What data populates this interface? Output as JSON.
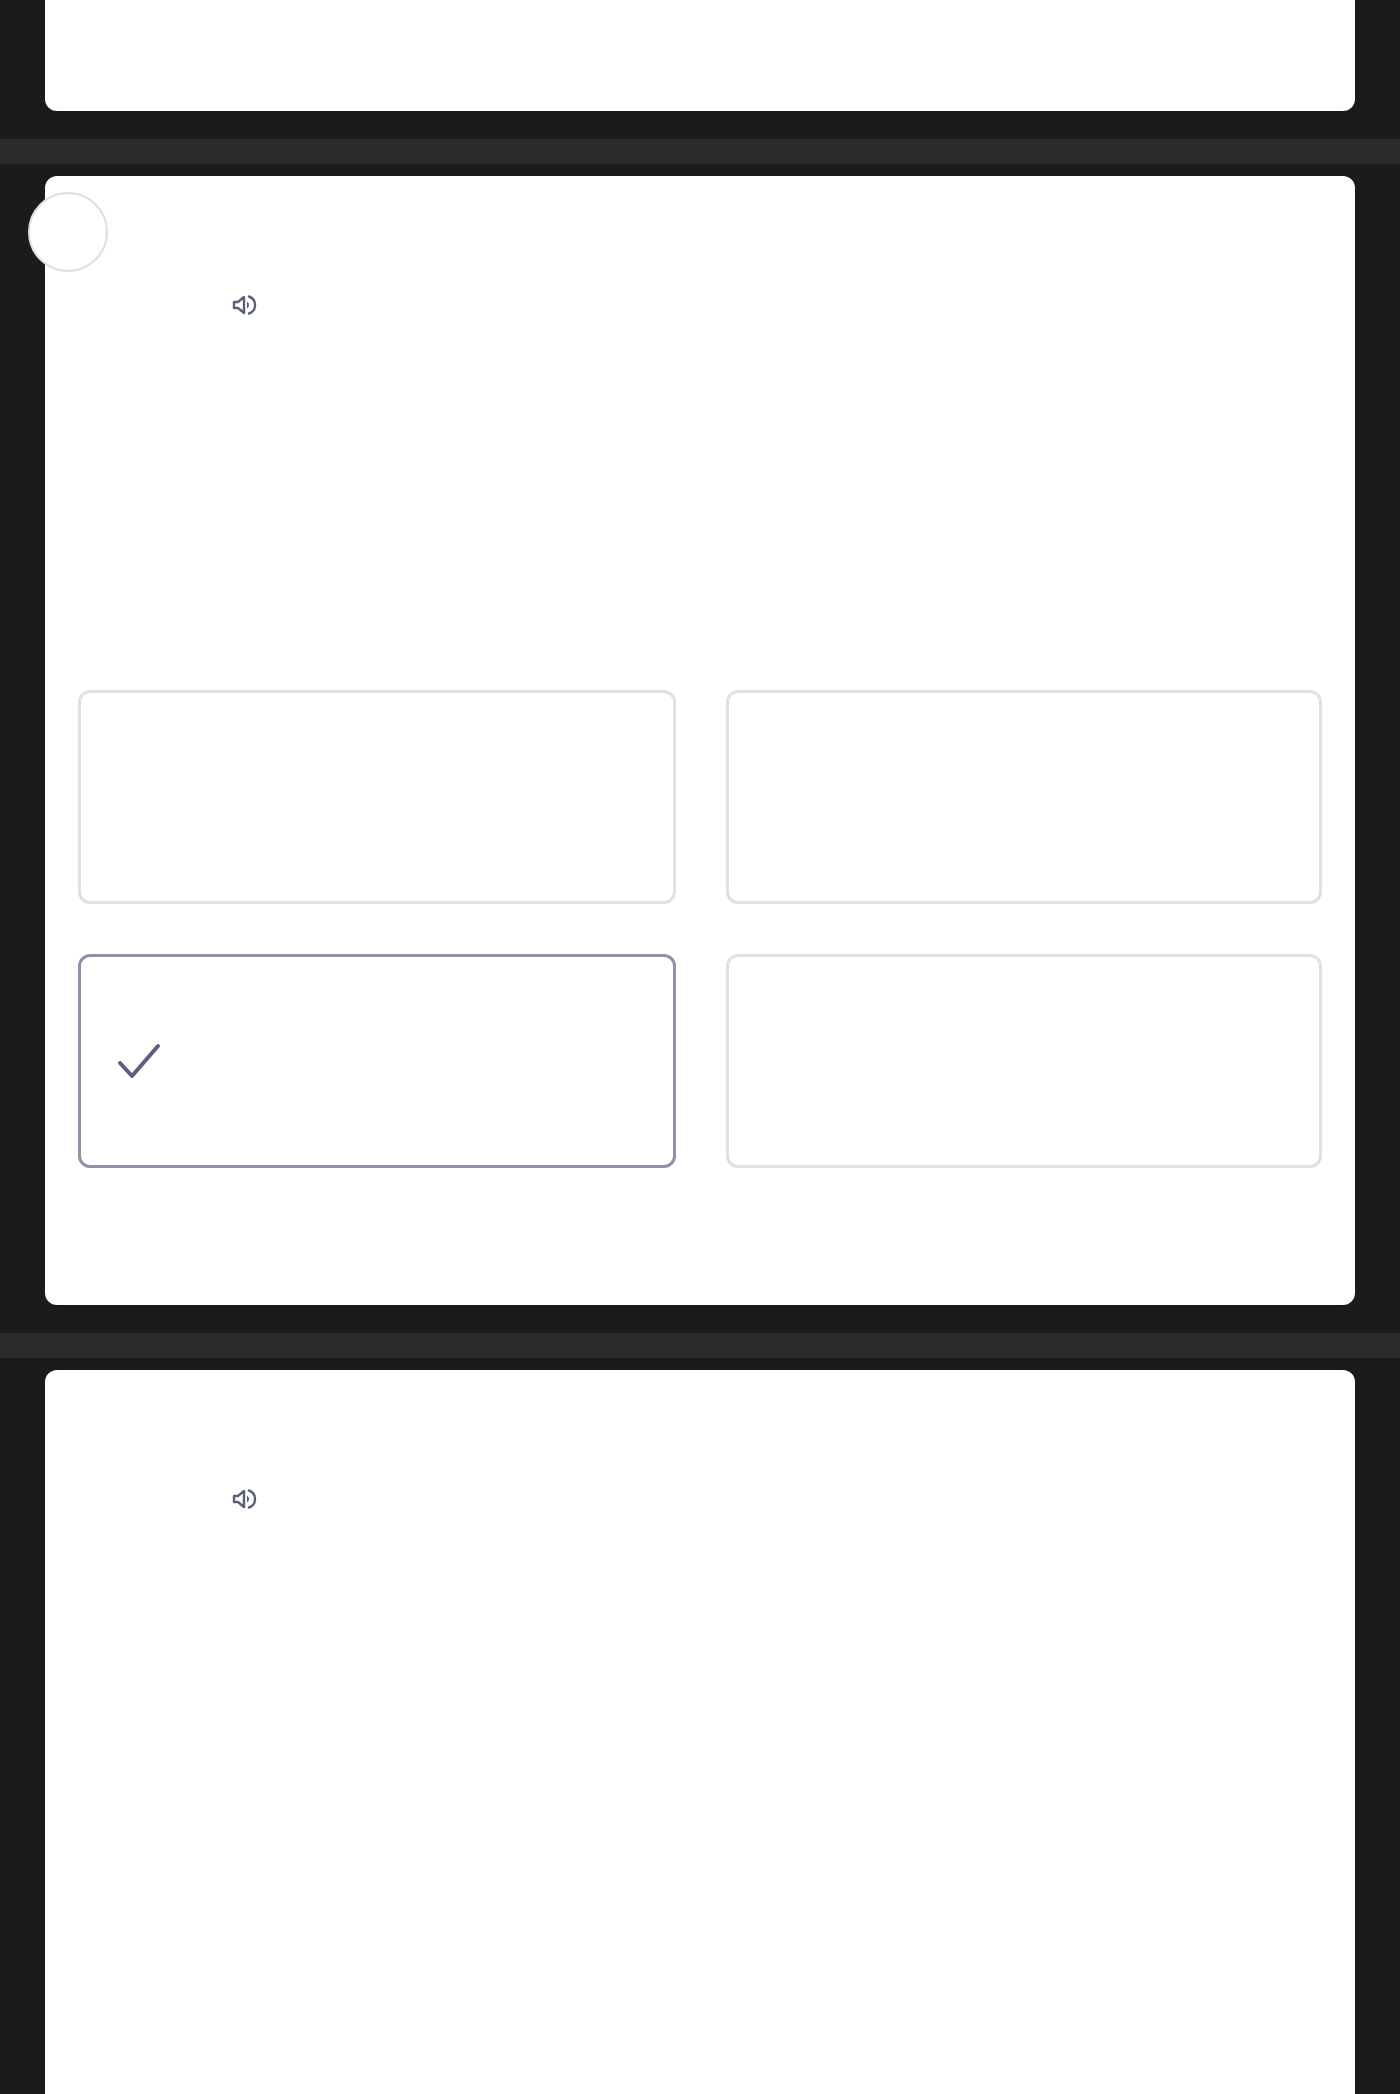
{
  "questions": [
    {
      "kind": "blank"
    },
    {
      "kind": "choice",
      "marker": true,
      "audio": true,
      "options": [
        {
          "selected": false
        },
        {
          "selected": false
        },
        {
          "selected": true
        },
        {
          "selected": false
        }
      ]
    },
    {
      "kind": "choice",
      "marker": false,
      "audio": true
    }
  ]
}
